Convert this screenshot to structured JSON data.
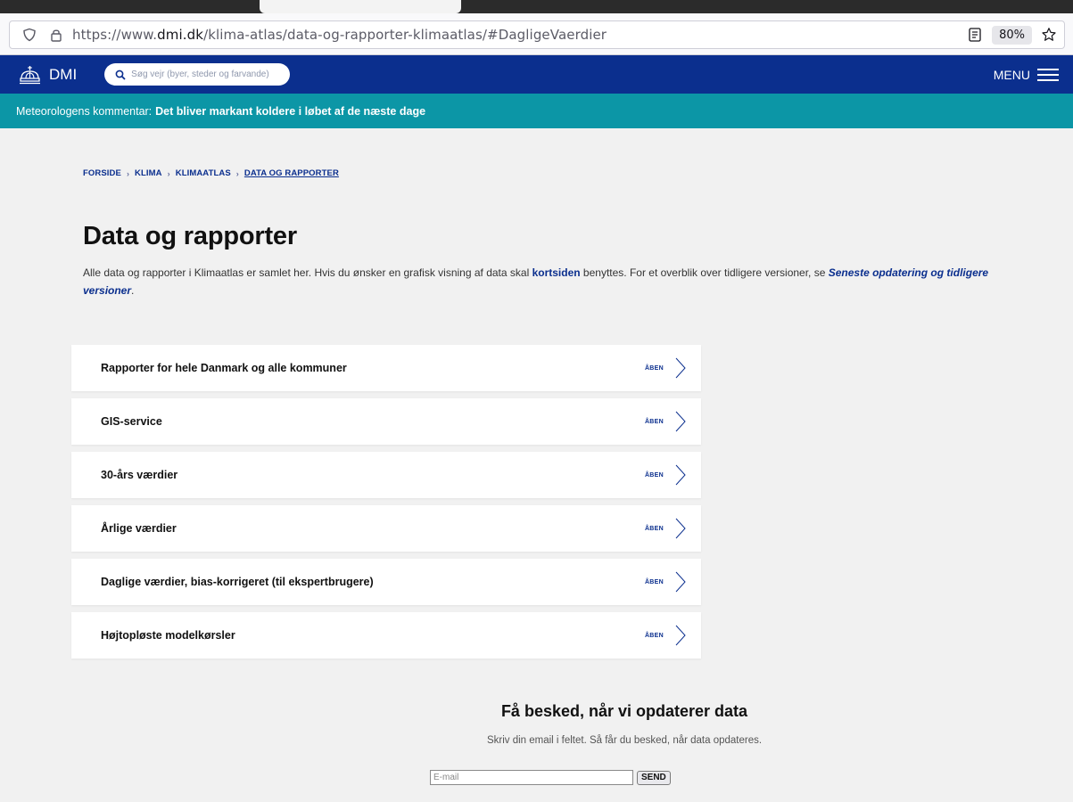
{
  "browser": {
    "url_prefix": "https://www.",
    "url_domain": "dmi.dk",
    "url_path": "/klima-atlas/data-og-rapporter-klimaatlas/#DagligeVaerdier",
    "zoom": "80%"
  },
  "header": {
    "logo_text": "DMI",
    "search_placeholder": "Søg vejr (byer, steder og farvande)",
    "menu_label": "MENU"
  },
  "teaser": {
    "prefix": "Meteorologens kommentar:",
    "message": "Det bliver markant koldere i løbet af de næste dage"
  },
  "breadcrumb": {
    "items": [
      "FORSIDE",
      "KLIMA",
      "KLIMAATLAS",
      "DATA OG RAPPORTER"
    ],
    "separator": "›"
  },
  "page": {
    "title": "Data og rapporter",
    "intro_1": "Alle data og rapporter i Klimaatlas er samlet her. Hvis du ønsker en grafisk visning af data skal ",
    "intro_link_1": "kortsiden",
    "intro_2": " benyttes. For et overblik over tidligere versioner, se ",
    "intro_link_2": "Seneste opdatering og tidligere versioner",
    "intro_3": "."
  },
  "sections": [
    {
      "label": "Rapporter for hele Danmark og alle kommuner",
      "action": "ÅBEN"
    },
    {
      "label": "GIS-service",
      "action": "ÅBEN"
    },
    {
      "label": "30-års værdier",
      "action": "ÅBEN"
    },
    {
      "label": "Årlige værdier",
      "action": "ÅBEN"
    },
    {
      "label": "Daglige værdier, bias-korrigeret (til ekspertbrugere)",
      "action": "ÅBEN"
    },
    {
      "label": "Højtopløste modelkørsler",
      "action": "ÅBEN"
    }
  ],
  "notify": {
    "title": "Få besked, når vi opdaterer data",
    "subtitle": "Skriv din email i feltet. Så får du besked, når data opdateres.",
    "email_placeholder": "E-mail",
    "send_label": "SEND"
  },
  "colors": {
    "header_blue": "#0b2f8e",
    "teaser_teal": "#0c96a6",
    "background": "#f1f1f1"
  }
}
